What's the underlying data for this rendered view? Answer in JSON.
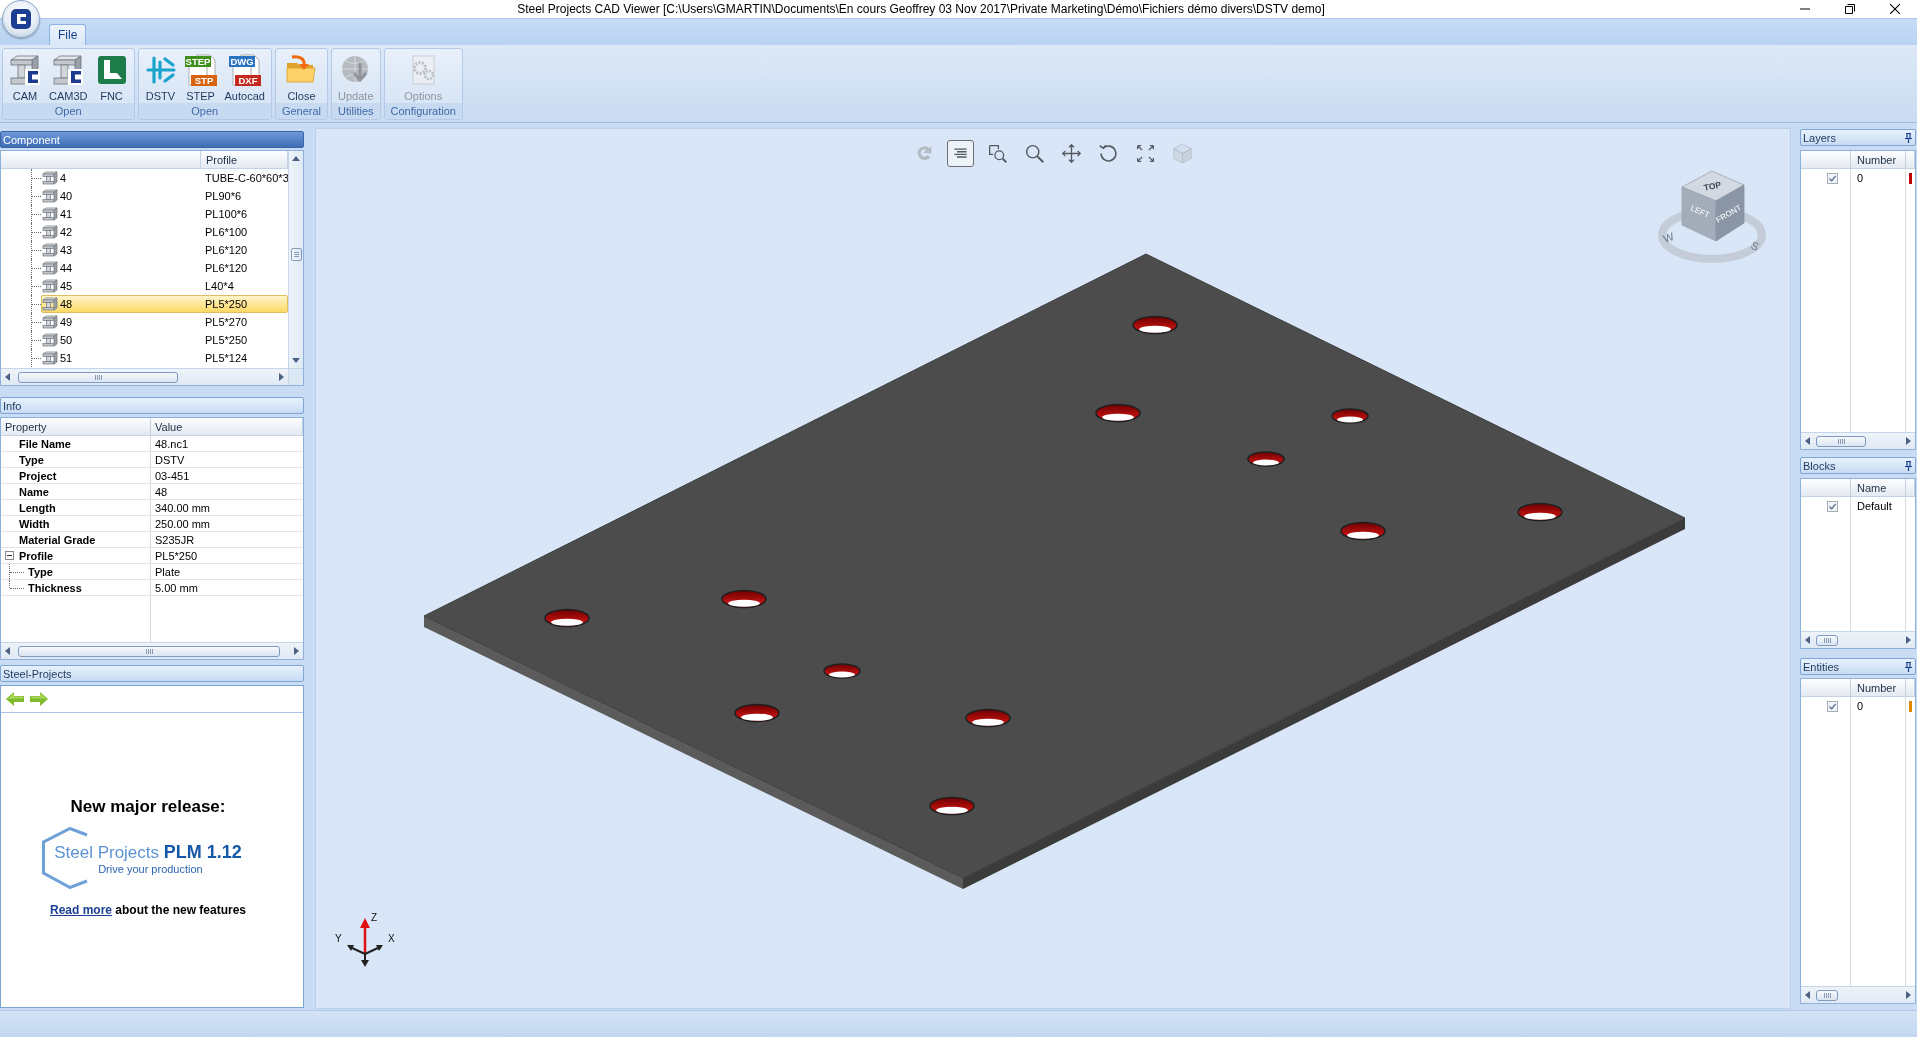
{
  "window": {
    "title": "Steel Projects CAD Viewer [C:\\Users\\GMARTIN\\Documents\\En cours Geoffrey 03 Nov 2017\\Private Marketing\\Démo\\Fichiers démo divers\\DSTV demo]"
  },
  "tabs": [
    {
      "label": "File",
      "selected": true
    }
  ],
  "ribbon": [
    {
      "label": "Open",
      "buttons": [
        {
          "label": "CAM",
          "disabled": false
        },
        {
          "label": "CAM3D",
          "disabled": false
        },
        {
          "label": "FNC",
          "disabled": false
        }
      ]
    },
    {
      "label": "Open",
      "buttons": [
        {
          "label": "DSTV",
          "disabled": false
        },
        {
          "label": "STEP",
          "disabled": false,
          "tags": [
            "STEP",
            "STP"
          ]
        },
        {
          "label": "Autocad",
          "disabled": false,
          "tags": [
            "DWG",
            "DXF"
          ]
        }
      ]
    },
    {
      "label": "General",
      "buttons": [
        {
          "label": "Close",
          "disabled": false
        }
      ]
    },
    {
      "label": "Utilities",
      "buttons": [
        {
          "label": "Update",
          "disabled": true
        }
      ]
    },
    {
      "label": "Configuration",
      "buttons": [
        {
          "label": "Options",
          "disabled": true
        }
      ]
    }
  ],
  "component": {
    "title": "Component",
    "active": true,
    "profile_column": "Profile",
    "rows": [
      {
        "label": "4",
        "profile": "TUBE-C-60*60*3",
        "selected": false
      },
      {
        "label": "40",
        "profile": "PL90*6",
        "selected": false
      },
      {
        "label": "41",
        "profile": "PL100*6",
        "selected": false
      },
      {
        "label": "42",
        "profile": "PL6*100",
        "selected": false
      },
      {
        "label": "43",
        "profile": "PL6*120",
        "selected": false
      },
      {
        "label": "44",
        "profile": "PL6*120",
        "selected": false
      },
      {
        "label": "45",
        "profile": "L40*4",
        "selected": false
      },
      {
        "label": "48",
        "profile": "PL5*250",
        "selected": true
      },
      {
        "label": "49",
        "profile": "PL5*270",
        "selected": false
      },
      {
        "label": "50",
        "profile": "PL5*250",
        "selected": false
      },
      {
        "label": "51",
        "profile": "PL5*124",
        "selected": false
      }
    ]
  },
  "info": {
    "title": "Info",
    "active": false,
    "columns": [
      "Property",
      "Value"
    ],
    "rows": [
      {
        "property": "File Name",
        "value": "48.nc1"
      },
      {
        "property": "Type",
        "value": "DSTV"
      },
      {
        "property": "Project",
        "value": "03-451"
      },
      {
        "property": "Name",
        "value": "48"
      },
      {
        "property": "Length",
        "value": "340.00 mm"
      },
      {
        "property": "Width",
        "value": "250.00 mm"
      },
      {
        "property": "Material Grade",
        "value": "S235JR"
      },
      {
        "property": "Profile",
        "value": "PL5*250",
        "expanded": true,
        "children": [
          {
            "property": "Type",
            "value": "Plate"
          },
          {
            "property": "Thickness",
            "value": "5.00 mm"
          }
        ]
      }
    ]
  },
  "news": {
    "title": "Steel-Projects",
    "active": false,
    "heading": "New major release:",
    "logo": "Steel Projects **PLM 1.12**",
    "tagline": "Drive your production",
    "link": "Read more",
    "text": "about the new features"
  },
  "viewport": {
    "tools": [
      {
        "disabled": true,
        "selected": false
      },
      {
        "disabled": false,
        "selected": true
      },
      {
        "disabled": false,
        "selected": false
      },
      {
        "disabled": false,
        "selected": false
      },
      {
        "disabled": false,
        "selected": false
      },
      {
        "disabled": false,
        "selected": false
      },
      {
        "disabled": false,
        "selected": false
      },
      {
        "disabled": true,
        "selected": false
      }
    ],
    "view_cube": {
      "faces": [
        "TOP",
        "LEFT",
        "FRONT"
      ],
      "compass": [
        "W",
        "S"
      ]
    },
    "axes": [
      "Z",
      "Y",
      "X"
    ]
  },
  "side_panels": [
    {
      "title": "Layers",
      "active": false,
      "column": "Number",
      "rows": [
        {
          "checked": true,
          "value": "0",
          "color": "#c00000"
        }
      ]
    },
    {
      "title": "Blocks",
      "active": false,
      "column": "Name",
      "rows": [
        {
          "checked": true,
          "value": "Default"
        }
      ]
    },
    {
      "title": "Entities",
      "active": false,
      "column": "Number",
      "rows": [
        {
          "checked": true,
          "value": "0",
          "color": "#e08a00"
        }
      ]
    }
  ]
}
